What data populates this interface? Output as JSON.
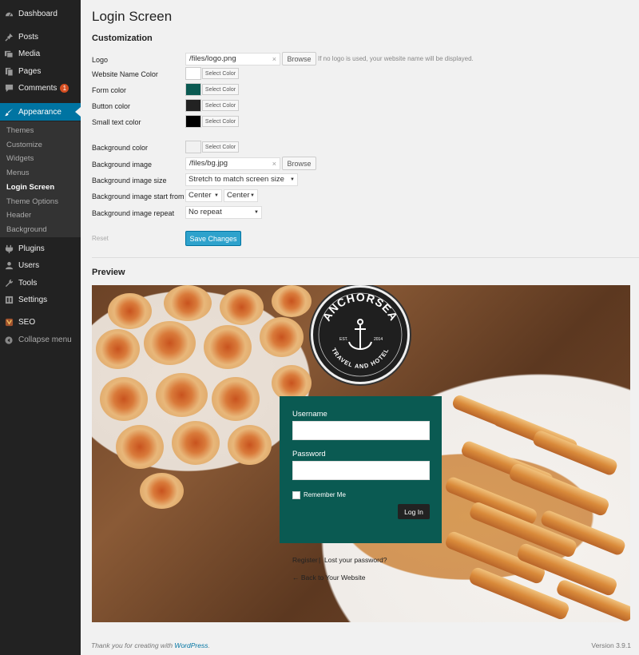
{
  "sidebar": {
    "top_items": [
      {
        "label": "Dashboard",
        "icon": "dashboard-icon"
      },
      {
        "label": "Posts",
        "icon": "pin-icon"
      },
      {
        "label": "Media",
        "icon": "media-icon"
      },
      {
        "label": "Pages",
        "icon": "pages-icon"
      },
      {
        "label": "Comments",
        "icon": "comment-icon",
        "badge": "1"
      },
      {
        "label": "Appearance",
        "icon": "brush-icon"
      }
    ],
    "submenu": [
      "Themes",
      "Customize",
      "Widgets",
      "Menus",
      "Login Screen",
      "Theme Options",
      "Header",
      "Background"
    ],
    "bottom_items": [
      {
        "label": "Plugins",
        "icon": "plugin-icon"
      },
      {
        "label": "Users",
        "icon": "user-icon"
      },
      {
        "label": "Tools",
        "icon": "wrench-icon"
      },
      {
        "label": "Settings",
        "icon": "settings-icon"
      },
      {
        "label": "SEO",
        "icon": "seo-icon"
      },
      {
        "label": "Collapse menu",
        "icon": "collapse-icon"
      }
    ]
  },
  "page": {
    "title": "Login Screen",
    "section_customization": "Customization",
    "section_preview": "Preview"
  },
  "form": {
    "logo_label": "Logo",
    "logo_value": "/files/logo.png",
    "browse_label": "Browse",
    "logo_hint": "If no logo is used, your website name will be displayed.",
    "site_name_color_label": "Website Name Color",
    "form_color_label": "Form color",
    "button_color_label": "Button color",
    "small_text_color_label": "Small text color",
    "background_color_label": "Background color",
    "select_color_label": "Select Color",
    "background_image_label": "Background image",
    "background_image_value": "/files/bg.jpg",
    "background_size_label": "Background image size",
    "background_size_value": "Stretch to match screen size",
    "background_start_label": "Background image start from",
    "background_start_x": "Center",
    "background_start_y": "Center",
    "background_repeat_label": "Background image repeat",
    "background_repeat_value": "No repeat",
    "reset_label": "Reset",
    "save_label": "Save Changes",
    "colors": {
      "site_name": "#ffffff",
      "form": "#0a5a52",
      "button": "#222222",
      "small_text": "#000000",
      "background": "#f1f1f1"
    }
  },
  "preview": {
    "logo_text": "ANCHORSEA",
    "logo_subtext": "TRAVEL AND HOTEL",
    "logo_est": "EST.",
    "logo_year": "2014",
    "username_label": "Username",
    "password_label": "Password",
    "remember_label": "Remember Me",
    "login_button": "Log In",
    "register_link": "Register",
    "separator": "|",
    "lost_password_link": "Lost your password?",
    "back_link": "← Back to Your Website"
  },
  "footer": {
    "thanks_prefix": "Thank you for creating with ",
    "thanks_link": "WordPress",
    "thanks_suffix": ".",
    "version": "Version 3.9.1"
  }
}
